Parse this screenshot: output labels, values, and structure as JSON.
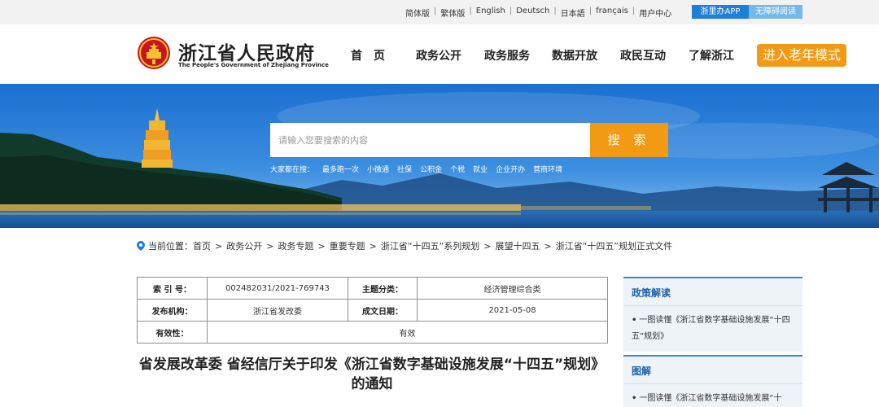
{
  "topbar": {
    "langs": [
      "简体版",
      "繁体版",
      "English",
      "Deutsch",
      "日本語",
      "français",
      "用户中心"
    ],
    "app_btn": "浙里办APP",
    "access_btn": "无障碍阅读"
  },
  "header": {
    "title": "浙江省人民政府",
    "subtitle": "The People's Government of Zhejiang Province",
    "nav": [
      "首　页",
      "政务公开",
      "政务服务",
      "数据开放",
      "政民互动",
      "了解浙江"
    ],
    "elder_mode": "进入老年模式"
  },
  "search": {
    "placeholder": "请输入您要搜索的内容",
    "button": "搜 索",
    "hot_label": "大家都在搜：",
    "hot_items": [
      "最多跑一次",
      "小微通",
      "社保",
      "公积金",
      "个税",
      "就业",
      "企业开办",
      "营商环境"
    ]
  },
  "breadcrumb": {
    "label": "当前位置：",
    "items": [
      "首页",
      "政务公开",
      "政务专题",
      "重要专题",
      "浙江省“十四五”系列规划",
      "展望十四五",
      "浙江省“十四五”规划正式文件"
    ]
  },
  "meta": {
    "index_label": "索 引 号：",
    "index_value": "002482031/2021-769743",
    "topic_label": "主题分类：",
    "topic_value": "经济管理综合类",
    "issuer_label": "发布机构：",
    "issuer_value": "浙江省发改委",
    "date_label": "成文日期：",
    "date_value": "2021-05-08",
    "validity_label": "有效性：",
    "validity_value": "有效"
  },
  "article": {
    "title": "省发展改革委 省经信厅关于印发《浙江省数字基础设施发展“十四五”规划》的通知"
  },
  "sidebar": {
    "policy_title": "政策解读",
    "policy_item": "一图读懂《浙江省数字基础设施发展“十四五”规划》",
    "graphic_title": "图解",
    "graphic_item": "一图读懂《浙江省数字基础设施发展“十"
  },
  "colors": {
    "brand_blue": "#1f7fd8",
    "accent_orange": "#f39a14",
    "panel_title": "#1f62ad"
  }
}
